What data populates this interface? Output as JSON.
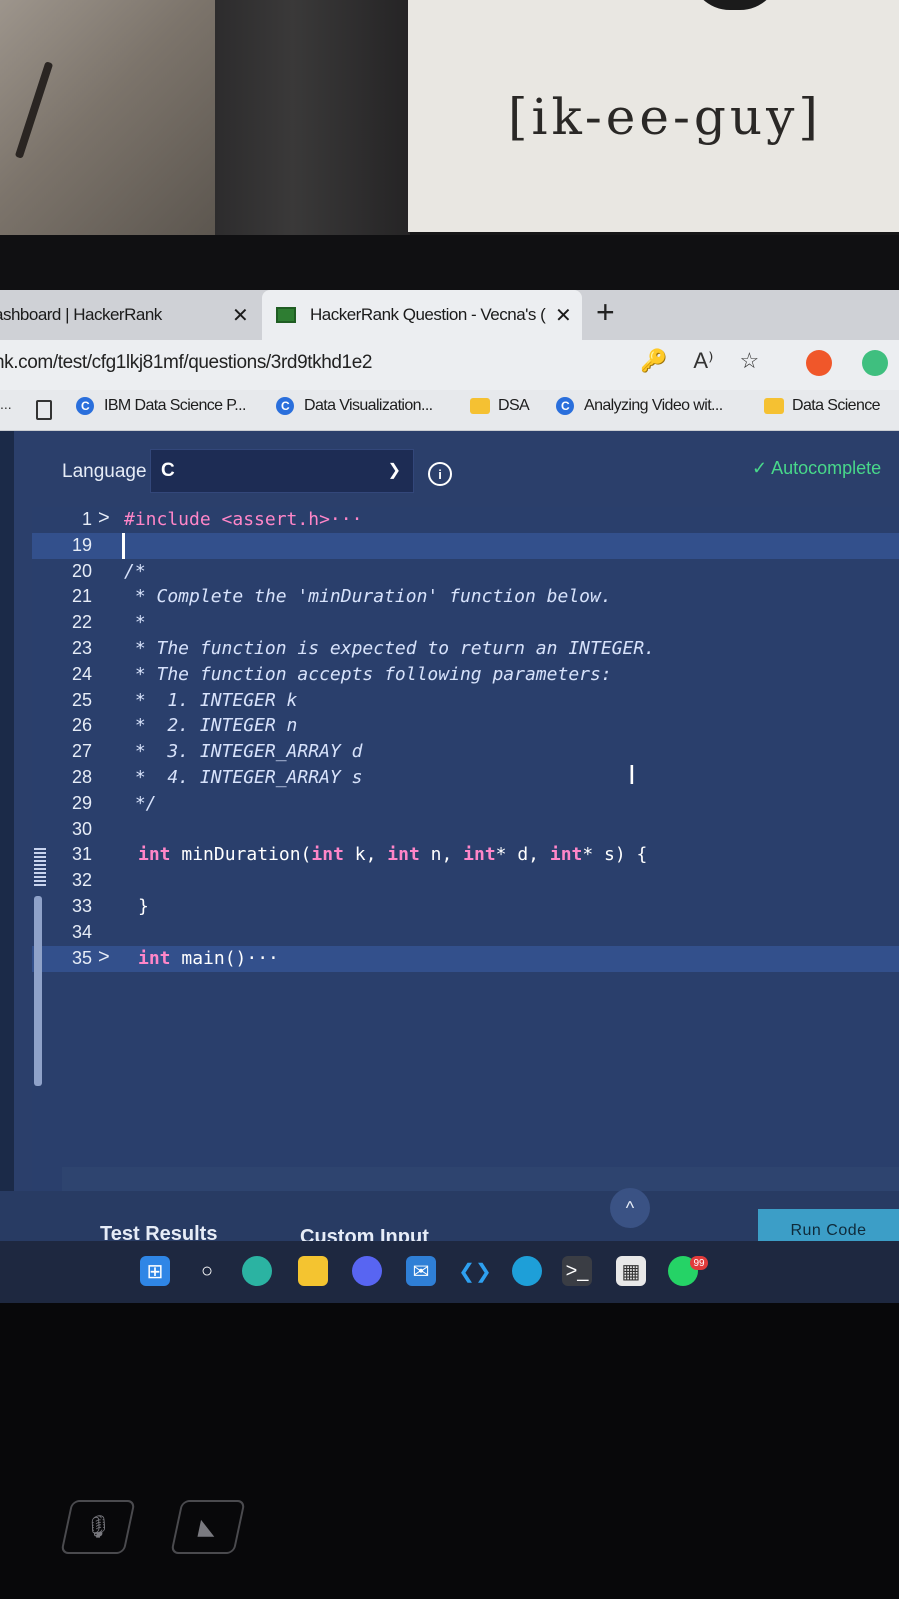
{
  "poster": {
    "text": "[ik-ee-guy]"
  },
  "browser": {
    "tabs": [
      {
        "title": "ashboard | HackerRank",
        "close": "✕"
      },
      {
        "title": "HackerRank Question - Vecna's (",
        "close": "✕"
      }
    ],
    "new_tab": "+",
    "url": "nk.com/test/cfg1lkj81mf/questions/3rd9tkhd1e2",
    "address_icons": [
      "🔑",
      "A⁾",
      "☆"
    ],
    "bookmarks": [
      {
        "label": "IBM Data Science P...",
        "icon": "c-icon"
      },
      {
        "label": "Data Visualization...",
        "icon": "c-icon"
      },
      {
        "label": "DSA",
        "icon": "folder-icon"
      },
      {
        "label": "Analyzing Video wit...",
        "icon": "c-icon"
      },
      {
        "label": "Data Science",
        "icon": "folder-icon"
      }
    ],
    "bookmarks_more": "..."
  },
  "editor_header": {
    "language_label": "Language",
    "language_value": "C",
    "info": "i",
    "autocomplete": "✓ Autocomplete"
  },
  "code_lines": [
    {
      "n": "1",
      "fold": ">",
      "text": "#include <assert.h>···"
    },
    {
      "n": "19",
      "fold": "",
      "text": ""
    },
    {
      "n": "20",
      "fold": "",
      "text": "/*"
    },
    {
      "n": "21",
      "fold": "",
      "text": " * Complete the 'minDuration' function below."
    },
    {
      "n": "22",
      "fold": "",
      "text": " *"
    },
    {
      "n": "23",
      "fold": "",
      "text": " * The function is expected to return an INTEGER."
    },
    {
      "n": "24",
      "fold": "",
      "text": " * The function accepts following parameters:"
    },
    {
      "n": "25",
      "fold": "",
      "text": " *  1. INTEGER k"
    },
    {
      "n": "26",
      "fold": "",
      "text": " *  2. INTEGER n"
    },
    {
      "n": "27",
      "fold": "",
      "text": " *  3. INTEGER_ARRAY d"
    },
    {
      "n": "28",
      "fold": "",
      "text": " *  4. INTEGER_ARRAY s"
    },
    {
      "n": "29",
      "fold": "",
      "text": " */"
    },
    {
      "n": "30",
      "fold": "",
      "text": ""
    },
    {
      "n": "31",
      "fold": "",
      "text": "int minDuration(int k, int n, int* d, int* s) {"
    },
    {
      "n": "32",
      "fold": "",
      "text": ""
    },
    {
      "n": "33",
      "fold": "",
      "text": "}"
    },
    {
      "n": "34",
      "fold": "",
      "text": ""
    },
    {
      "n": "35",
      "fold": ">",
      "text": "int main()···"
    }
  ],
  "bottom": {
    "test_results": "Test Results",
    "custom_input": "Custom Input",
    "run_code": "Run Code",
    "collapse": "^"
  },
  "taskbar": {
    "whatsapp_badge": "99"
  },
  "colors": {
    "editor_bg": "#2a3f6c",
    "keyword": "#ff86c8",
    "accent_green": "#48d88a",
    "run_button": "#3c9ec7"
  }
}
